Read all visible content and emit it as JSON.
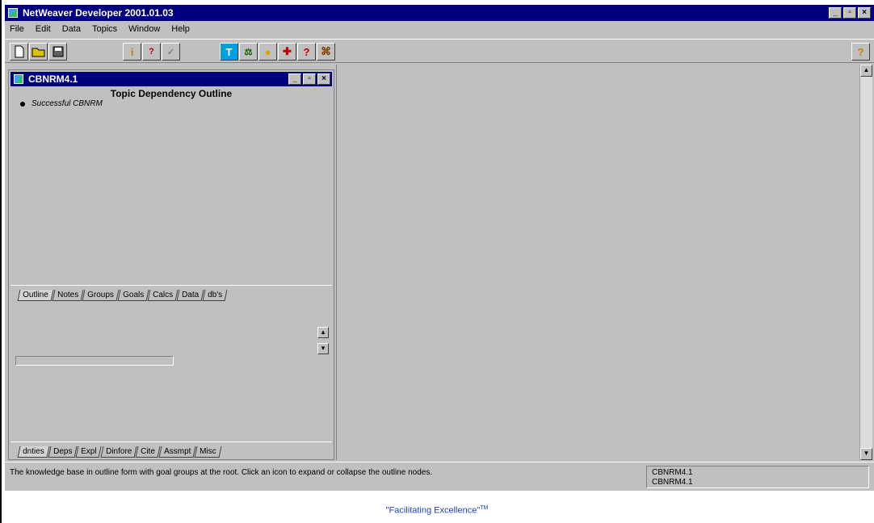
{
  "app": {
    "title": "NetWeaver Developer 2001.01.03",
    "menu": [
      "File",
      "Edit",
      "Data",
      "Topics",
      "Window",
      "Help"
    ]
  },
  "toolbar": {
    "icons": [
      "new-icon",
      "open-icon",
      "save-icon",
      "info-icon",
      "query-topic-icon",
      "check-icon",
      "topic-icon",
      "scale-icon",
      "lightbulb-icon",
      "ask-icon",
      "help-query-icon",
      "link-icon",
      "context-help-icon"
    ]
  },
  "child_window": {
    "title": "CBNRM4.1",
    "outline_heading": "Topic Dependency Outline",
    "outline_item": "Successful CBNRM",
    "tabs_top": [
      "Outline",
      "Notes",
      "Groups",
      "Goals",
      "Calcs",
      "Data",
      "db's"
    ],
    "tabs_bottom": [
      "dnties",
      "Deps",
      "Expl",
      "Dinfore",
      "Cite",
      "Assmpt",
      "Misc"
    ]
  },
  "statusbar": {
    "message": "The knowledge base in outline form with goal groups at the root.  Click an icon to expand or collapse the outline nodes.",
    "kb_line1": "CBNRM4.1",
    "kb_line2": "CBNRM4.1"
  },
  "footer": {
    "text": "\"Facilitating Excellence\"",
    "mark": "TM"
  },
  "colors": {
    "titlebar": "#000080",
    "face": "#c0c0c0",
    "footer_text": "#1f3fbf"
  }
}
